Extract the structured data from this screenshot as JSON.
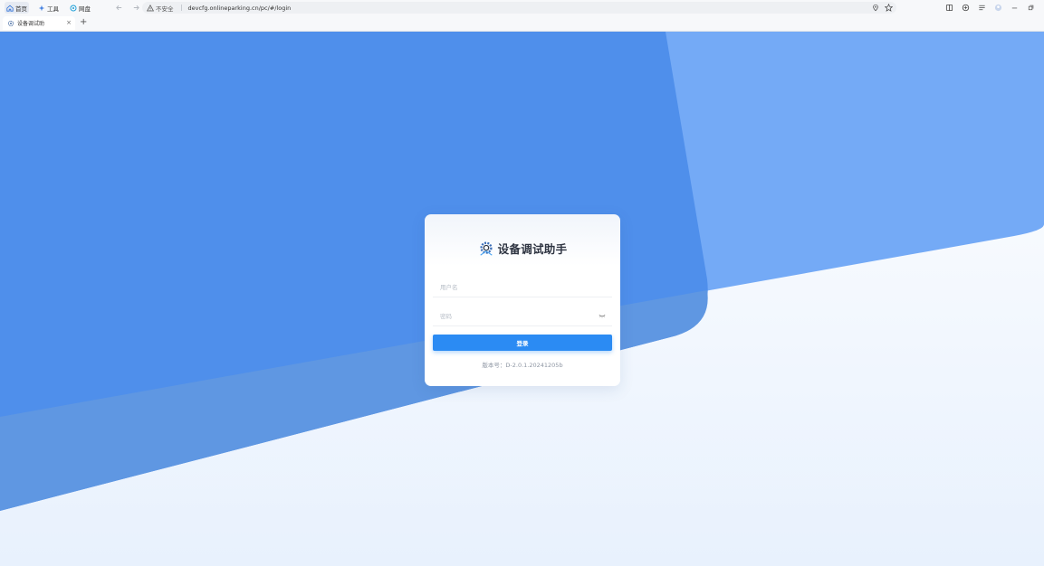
{
  "browser": {
    "quick_links": [
      {
        "label": "首页"
      },
      {
        "label": "工具"
      },
      {
        "label": "网盘"
      }
    ],
    "security_label": "不安全",
    "url": "devcfg.onlineparking.cn/pc/#/login",
    "tab": {
      "title": "设备调试助",
      "close": "×"
    },
    "new_tab": "+"
  },
  "login": {
    "title": "设备调试助手",
    "username_placeholder": "用户名",
    "password_placeholder": "密码",
    "submit_label": "登录",
    "version_text": "版本号：D-2.0.1.20241205b"
  },
  "colors": {
    "accent": "#2b8bf3",
    "bg_dark_blue": "#4f8feb",
    "bg_light_blue": "#74aaf6"
  }
}
